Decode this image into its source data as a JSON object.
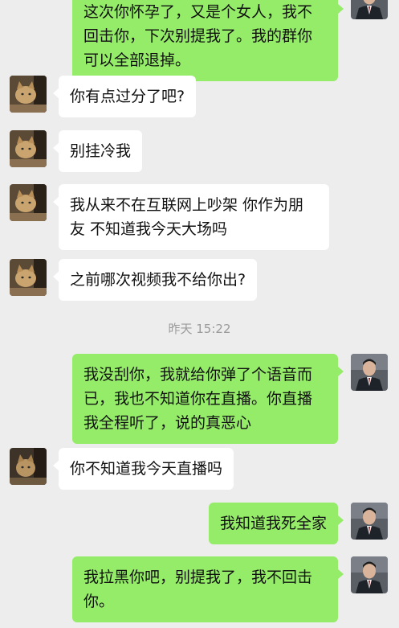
{
  "messages": [
    {
      "side": "right",
      "text": "这次你怀孕了，又是个女人，我不回击你，下次别提我了。我的群你可以全部退掉。"
    },
    {
      "side": "left",
      "text": "你有点过分了吧?"
    },
    {
      "side": "left",
      "text": "别挂冷我"
    },
    {
      "side": "left",
      "text": "我从来不在互联网上吵架 你作为朋友 不知道我今天大场吗"
    },
    {
      "side": "left",
      "text": "之前哪次视频我不给你出?"
    },
    {
      "side": "right",
      "text": "我没刮你，我就给你弹了个语音而已，我也不知道你在直播。你直播我全程听了，说的真恶心"
    },
    {
      "side": "left",
      "text": "你不知道我今天直播吗"
    },
    {
      "side": "right",
      "text": "我知道我死全家"
    },
    {
      "side": "right",
      "text": "我拉黑你吧，别提我了，我不回击你。"
    }
  ],
  "timestamp": "昨天 15:22",
  "colors": {
    "background": "#ededed",
    "self_bubble": "#95ec69",
    "other_bubble": "#ffffff",
    "timestamp_text": "#9a9a9a"
  },
  "avatars": {
    "self": "man-in-suit-avatar",
    "other": "cat-photo-avatar"
  }
}
